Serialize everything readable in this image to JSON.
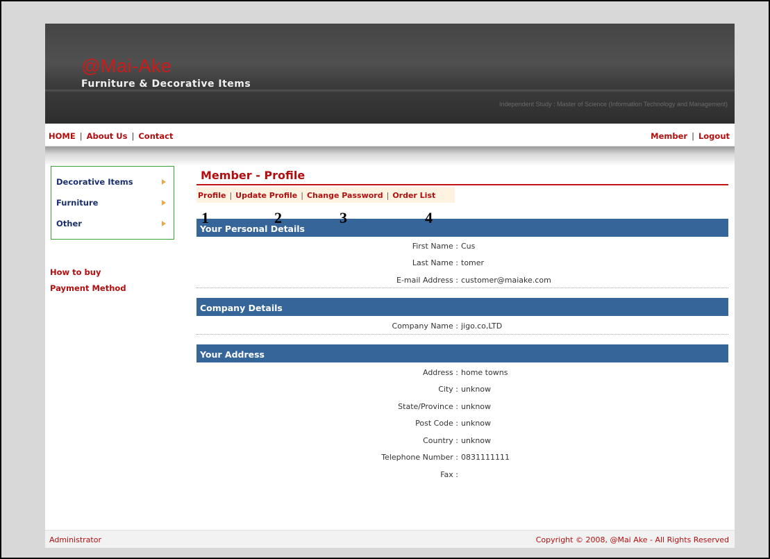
{
  "header": {
    "logo": "@Mai-Ake",
    "tagline": "Furniture & Decorative Items",
    "subtitle": "Independent Study : Master of Science (Information Technology and Management)"
  },
  "topnav": {
    "left": [
      "HOME",
      "About Us",
      "Contact"
    ],
    "right": [
      "Member",
      "Logout"
    ]
  },
  "categories": [
    "Decorative Items",
    "Furniture",
    "Other"
  ],
  "sidelinks": [
    "How to buy",
    "Payment Method"
  ],
  "page": {
    "title": "Member - Profile",
    "subnav": [
      "Profile",
      "Update Profile",
      "Change Password",
      "Order List"
    ],
    "annotations": [
      "1",
      "2",
      "3",
      "4"
    ]
  },
  "sections": {
    "personal": {
      "heading": "Your Personal Details",
      "fields": [
        {
          "label": "First Name :",
          "value": "Cus"
        },
        {
          "label": "Last Name :",
          "value": "tomer"
        },
        {
          "label": "E-mail Address :",
          "value": "customer@maiake.com"
        }
      ]
    },
    "company": {
      "heading": "Company Details",
      "fields": [
        {
          "label": "Company Name :",
          "value": "jigo.co,LTD"
        }
      ]
    },
    "address": {
      "heading": "Your Address",
      "fields": [
        {
          "label": "Address :",
          "value": "home towns"
        },
        {
          "label": "City :",
          "value": "unknow"
        },
        {
          "label": "State/Province :",
          "value": "unknow"
        },
        {
          "label": "Post Code :",
          "value": "unknow"
        },
        {
          "label": "Country :",
          "value": "unknow"
        },
        {
          "label": "Telephone Number :",
          "value": "0831111111"
        },
        {
          "label": "Fax :",
          "value": ""
        }
      ]
    }
  },
  "footer": {
    "left": "Administrator",
    "right": "Copyright © 2008, @Mai Ake - All Rights Reserved"
  },
  "colors": {
    "accent_red": "#b10f0f",
    "section_blue": "#356599",
    "category_border": "#3aa23a"
  }
}
